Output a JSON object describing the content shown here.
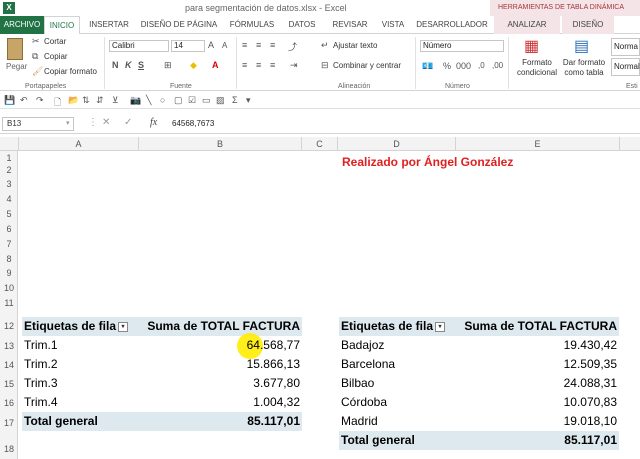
{
  "window": {
    "app_icon": "X",
    "doc_title": "para segmentación de datos.xlsx - Excel",
    "tools_group_title": "HERRAMIENTAS DE TABLA DINÁMICA"
  },
  "tabs": {
    "archivo": "ARCHIVO",
    "inicio": "INICIO",
    "insertar": "INSERTAR",
    "diseno_pagina": "DISEÑO DE PÁGINA",
    "formulas": "FÓRMULAS",
    "datos": "DATOS",
    "revisar": "REVISAR",
    "vista": "VISTA",
    "desarrollador": "DESARROLLADOR",
    "analizar": "ANALIZAR",
    "diseno": "DISEÑO"
  },
  "ribbon": {
    "paste_label": "Pegar",
    "cut_label": "Cortar",
    "copy_label": "Copiar",
    "copy_format_label": "Copiar formato",
    "clipboard_group": "Portapapeles",
    "font_name": "Calibri",
    "font_size": "14",
    "font_group": "Fuente",
    "wrap_text_label": "Ajustar texto",
    "merge_center_label": "Combinar y centrar",
    "alignment_group": "Alineación",
    "number_format": "Número",
    "number_group": "Número",
    "conditional_format_label": "Formato condicional",
    "format_as_table_label": "Dar formato como tabla",
    "style_normal_1": "Norma",
    "style_normal_2": "Normal",
    "styles_group": "Esti"
  },
  "formula_bar": {
    "name_box": "B13",
    "fx": "fx",
    "formula": "64568,7673"
  },
  "columns": [
    "A",
    "B",
    "C",
    "D",
    "E"
  ],
  "rows": [
    "1",
    "2",
    "3",
    "4",
    "5",
    "6",
    "7",
    "8",
    "9",
    "10",
    "11",
    "12",
    "13",
    "14",
    "15",
    "16",
    "17",
    "18"
  ],
  "credit": "Realizado por Ángel González",
  "pivot_left": {
    "row_label_header": "Etiquetas de fila",
    "value_header": "Suma de TOTAL FACTURA",
    "rows": [
      {
        "label": "Trim.1",
        "value": "64.568,77"
      },
      {
        "label": "Trim.2",
        "value": "15.866,13"
      },
      {
        "label": "Trim.3",
        "value": "3.677,80"
      },
      {
        "label": "Trim.4",
        "value": "1.004,32"
      }
    ],
    "total_label": "Total general",
    "total_value": "85.117,01"
  },
  "pivot_right": {
    "row_label_header": "Etiquetas de fila",
    "value_header": "Suma de TOTAL FACTURA",
    "rows": [
      {
        "label": "Badajoz",
        "value": "19.430,42"
      },
      {
        "label": "Barcelona",
        "value": "12.509,35"
      },
      {
        "label": "Bilbao",
        "value": "24.088,31"
      },
      {
        "label": "Córdoba",
        "value": "10.070,83"
      },
      {
        "label": "Madrid",
        "value": "19.018,10"
      }
    ],
    "total_label": "Total general",
    "total_value": "85.117,01"
  }
}
